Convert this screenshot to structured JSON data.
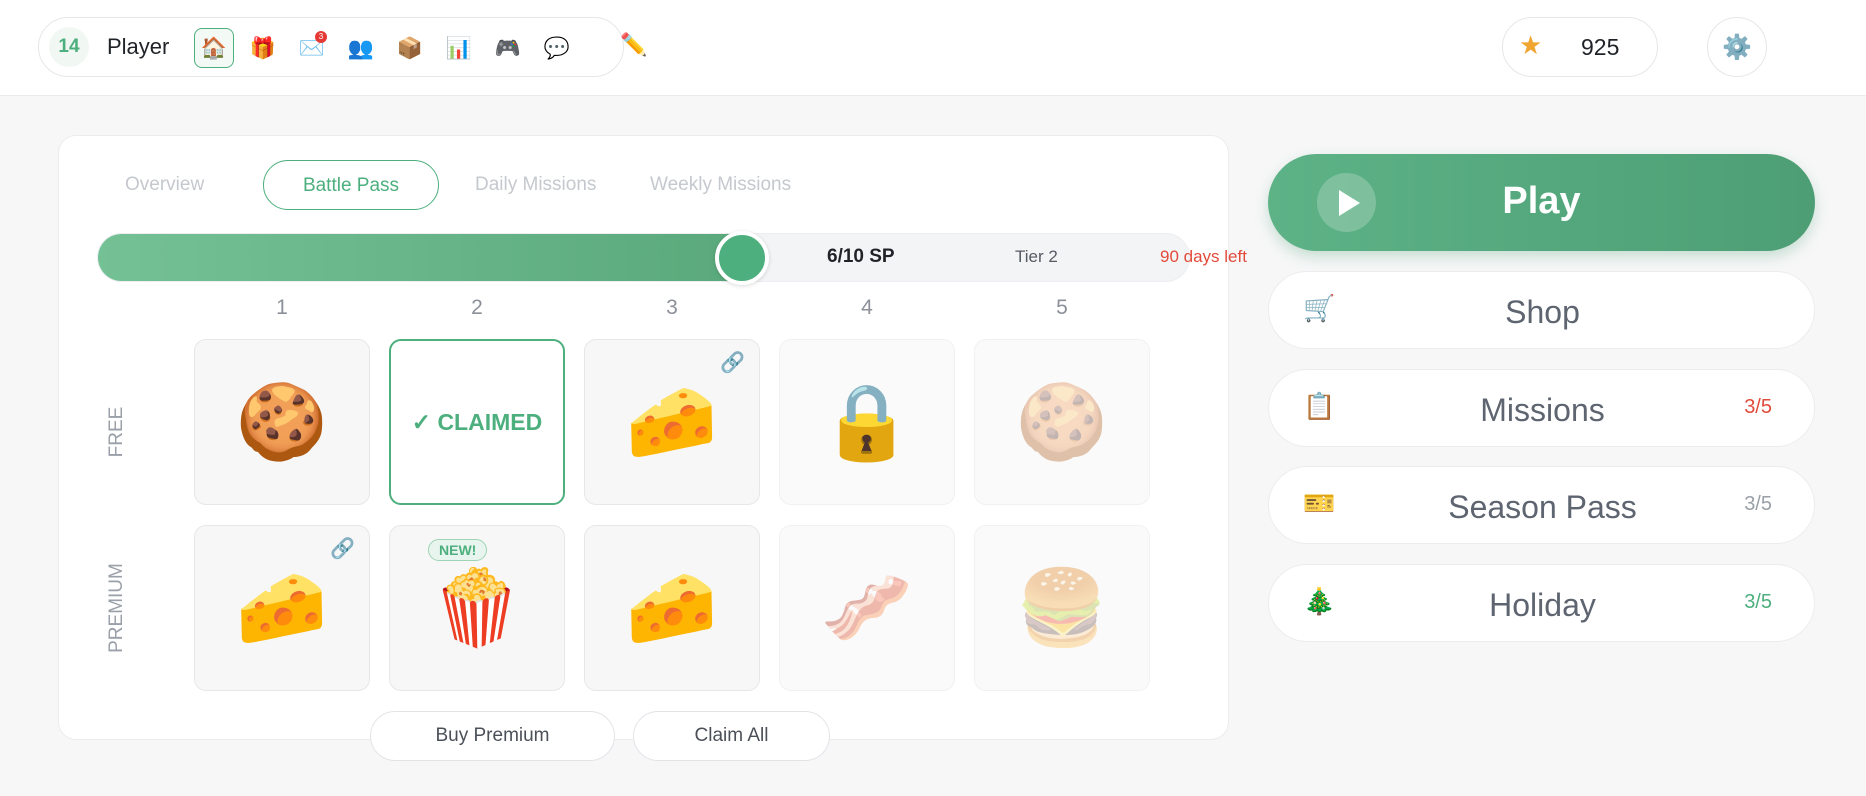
{
  "header": {
    "level": "14",
    "player_name": "Player",
    "nav_icons": [
      {
        "name": "home-icon",
        "glyph": "🏠",
        "active": true
      },
      {
        "name": "gift-icon",
        "glyph": "🎁"
      },
      {
        "name": "mail-icon",
        "glyph": "✉️",
        "badge": "3"
      },
      {
        "name": "friends-icon",
        "glyph": "👥"
      },
      {
        "name": "inventory-box-icon",
        "glyph": "📦"
      },
      {
        "name": "stats-chart-icon",
        "glyph": "📊"
      },
      {
        "name": "gamepad-icon",
        "glyph": "🎮"
      },
      {
        "name": "chat-icon",
        "glyph": "💬"
      }
    ],
    "edit_icon": "✏️",
    "currency_value": "925",
    "currency_icon": "★",
    "settings_icon": "⚙️"
  },
  "tabs": [
    {
      "label": "Overview",
      "active": false
    },
    {
      "label": "Battle Pass",
      "active": true
    },
    {
      "label": "Daily Missions",
      "active": false
    },
    {
      "label": "Weekly Missions",
      "active": false
    }
  ],
  "progress": {
    "fraction": 0.6,
    "sp_text": "6/10 SP",
    "tier_text": "Tier 2",
    "days_left": "90 days left"
  },
  "tiers": [
    "1",
    "2",
    "3",
    "4",
    "5"
  ],
  "rows": {
    "free_label": "FREE",
    "premium_label": "PREMIUM"
  },
  "free_rewards": [
    {
      "emoji": "🍪",
      "state": "available"
    },
    {
      "emoji": "",
      "state": "claimed",
      "text": "✓ CLAIMED"
    },
    {
      "emoji": "🧀",
      "state": "available",
      "chain": "🔗"
    },
    {
      "emoji": "🔒",
      "state": "locked"
    },
    {
      "emoji": "🍪",
      "state": "dim"
    }
  ],
  "premium_rewards": [
    {
      "emoji": "🧀",
      "state": "available",
      "chain": "🔗"
    },
    {
      "emoji": "🍿",
      "state": "available",
      "badge": "NEW!"
    },
    {
      "emoji": "🧀",
      "state": "available"
    },
    {
      "emoji": "🥓",
      "state": "dim"
    },
    {
      "emoji": "🍔",
      "state": "dim"
    }
  ],
  "actions": {
    "buy_premium": "Buy Premium",
    "claim_all": "Claim All"
  },
  "play": {
    "label": "Play"
  },
  "menu": [
    {
      "label": "Shop",
      "icon": "🛒",
      "count": "",
      "count_color": "#9aa0a8"
    },
    {
      "label": "Missions",
      "icon": "📋",
      "count": "3/5",
      "count_color": "#e24b3b"
    },
    {
      "label": "Season Pass",
      "icon": "🎫",
      "count": "3/5",
      "count_color": "#9aa0a8"
    },
    {
      "label": "Holiday",
      "icon": "🎄",
      "count": "3/5",
      "count_color": "#4caf7d"
    }
  ]
}
